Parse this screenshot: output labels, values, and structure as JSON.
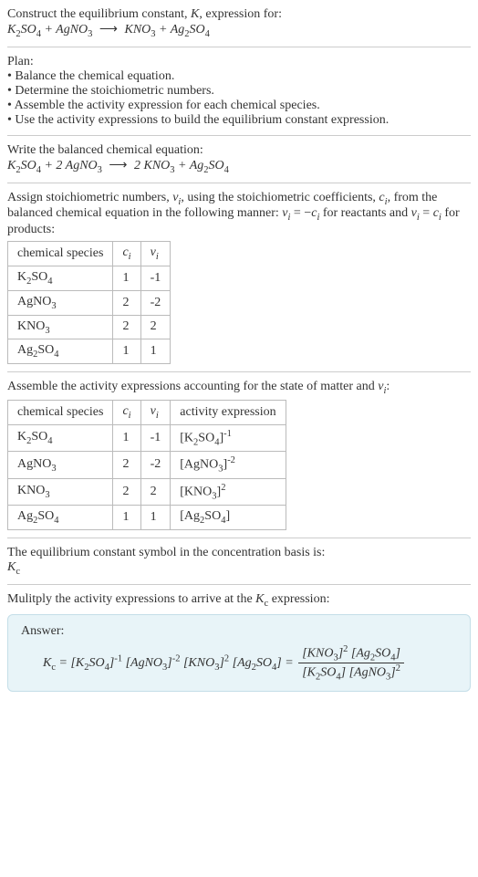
{
  "intro": {
    "line1": "Construct the equilibrium constant, K, expression for:",
    "eq": "K₂SO₄ + AgNO₃ ⟶ KNO₃ + Ag₂SO₄"
  },
  "plan": {
    "heading": "Plan:",
    "b1": "• Balance the chemical equation.",
    "b2": "• Determine the stoichiometric numbers.",
    "b3": "• Assemble the activity expression for each chemical species.",
    "b4": "• Use the activity expressions to build the equilibrium constant expression."
  },
  "balanced": {
    "heading": "Write the balanced chemical equation:",
    "eq": "K₂SO₄ + 2 AgNO₃ ⟶ 2 KNO₃ + Ag₂SO₄"
  },
  "stoich": {
    "heading_part1": "Assign stoichiometric numbers, ",
    "heading_part2": ", using the stoichiometric coefficients, ",
    "heading_part3": ", from the balanced chemical equation in the following manner: ",
    "heading_part4": " for reactants and ",
    "heading_part5": " for products:",
    "cols": {
      "c0": "chemical species",
      "c1": "cᵢ",
      "c2": "νᵢ"
    },
    "rows": [
      {
        "s": "K₂SO₄",
        "c": "1",
        "v": "-1"
      },
      {
        "s": "AgNO₃",
        "c": "2",
        "v": "-2"
      },
      {
        "s": "KNO₃",
        "c": "2",
        "v": "2"
      },
      {
        "s": "Ag₂SO₄",
        "c": "1",
        "v": "1"
      }
    ]
  },
  "activity": {
    "heading": "Assemble the activity expressions accounting for the state of matter and νᵢ:",
    "cols": {
      "c0": "chemical species",
      "c1": "cᵢ",
      "c2": "νᵢ",
      "c3": "activity expression"
    },
    "rows": [
      {
        "s": "K₂SO₄",
        "c": "1",
        "v": "-1",
        "a_base": "[K₂SO₄]",
        "a_exp": "-1"
      },
      {
        "s": "AgNO₃",
        "c": "2",
        "v": "-2",
        "a_base": "[AgNO₃]",
        "a_exp": "-2"
      },
      {
        "s": "KNO₃",
        "c": "2",
        "v": "2",
        "a_base": "[KNO₃]",
        "a_exp": "2"
      },
      {
        "s": "Ag₂SO₄",
        "c": "1",
        "v": "1",
        "a_base": "[Ag₂SO₄]",
        "a_exp": ""
      }
    ]
  },
  "symbol": {
    "heading": "The equilibrium constant symbol in the concentration basis is:",
    "val": "K",
    "sub": "c"
  },
  "multiply": {
    "heading": "Mulitply the activity expressions to arrive at the Kc expression:"
  },
  "answer": {
    "label": "Answer:",
    "lhs_k": "K",
    "lhs_sub": "c",
    "eq": " = ",
    "t1": "[K₂SO₄]",
    "e1": "-1",
    "t2": "[AgNO₃]",
    "e2": "-2",
    "t3": "[KNO₃]",
    "e3": "2",
    "t4": "[Ag₂SO₄]",
    "num1": "[KNO₃]",
    "ne1": "2",
    "num2": "[Ag₂SO₄]",
    "den1": "[K₂SO₄]",
    "den2": "[AgNO₃]",
    "de2": "2"
  },
  "chart_data": {
    "type": "table",
    "tables": [
      {
        "title": "Stoichiometric numbers",
        "columns": [
          "chemical species",
          "c_i",
          "ν_i"
        ],
        "rows": [
          [
            "K2SO4",
            1,
            -1
          ],
          [
            "AgNO3",
            2,
            -2
          ],
          [
            "KNO3",
            2,
            2
          ],
          [
            "Ag2SO4",
            1,
            1
          ]
        ]
      },
      {
        "title": "Activity expressions",
        "columns": [
          "chemical species",
          "c_i",
          "ν_i",
          "activity expression"
        ],
        "rows": [
          [
            "K2SO4",
            1,
            -1,
            "[K2SO4]^-1"
          ],
          [
            "AgNO3",
            2,
            -2,
            "[AgNO3]^-2"
          ],
          [
            "KNO3",
            2,
            2,
            "[KNO3]^2"
          ],
          [
            "Ag2SO4",
            1,
            1,
            "[Ag2SO4]"
          ]
        ]
      }
    ]
  }
}
